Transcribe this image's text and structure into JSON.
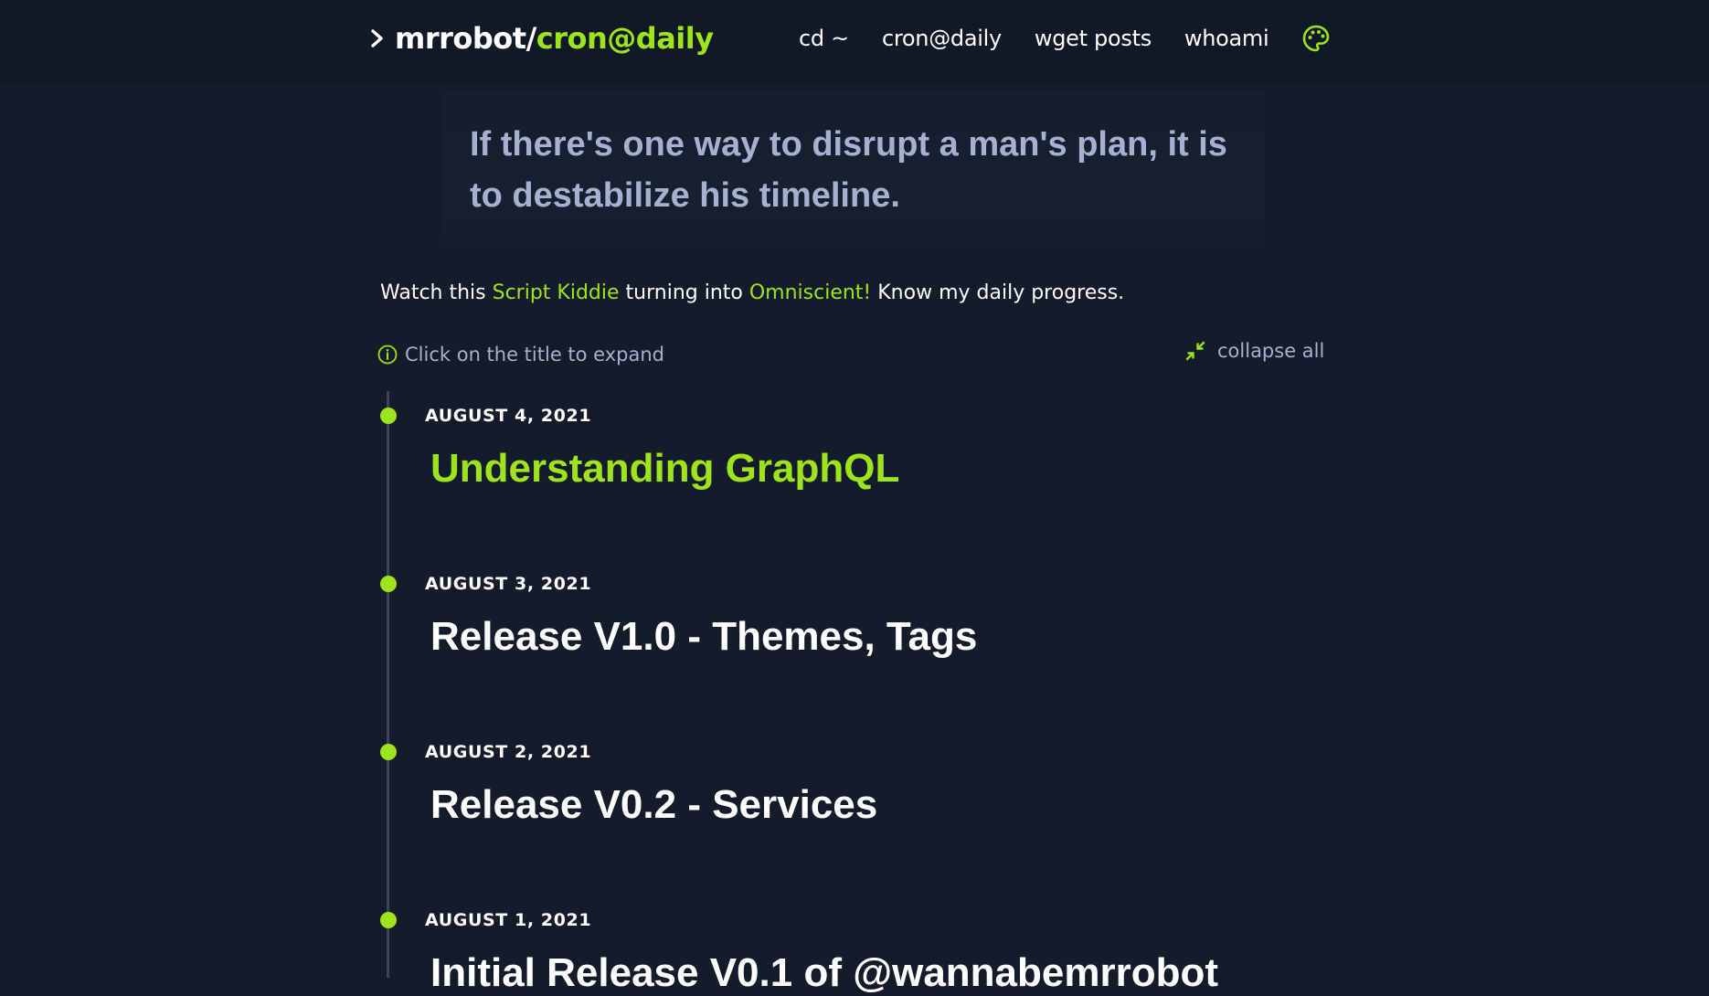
{
  "header": {
    "brand_prefix": "mrrobot/",
    "brand_accent": "cron@daily",
    "nav": [
      "cd ~",
      "cron@daily",
      "wget posts",
      "whoami"
    ],
    "theme_icon": "palette-icon"
  },
  "quote": "If there's one way to disrupt a man's plan, it is to destabilize his timeline.",
  "tagline": {
    "part1": "Watch this ",
    "hl1": "Script Kiddie",
    "part2": " turning into ",
    "hl2": "Omniscient!",
    "part3": " Know my daily progress."
  },
  "hint": "Click on the title to expand",
  "collapse_label": "collapse all",
  "posts": [
    {
      "date": "AUGUST 4, 2021",
      "title": "Understanding GraphQL"
    },
    {
      "date": "AUGUST 3, 2021",
      "title": "Release V1.0 - Themes, Tags"
    },
    {
      "date": "AUGUST 2, 2021",
      "title": "Release V0.2 - Services"
    },
    {
      "date": "AUGUST 1, 2021",
      "title": "Initial Release V0.1 of @wannabemrrobot"
    }
  ],
  "colors": {
    "background": "#141b2b",
    "accent": "#9ee31c",
    "muted": "#a5b2cf"
  }
}
